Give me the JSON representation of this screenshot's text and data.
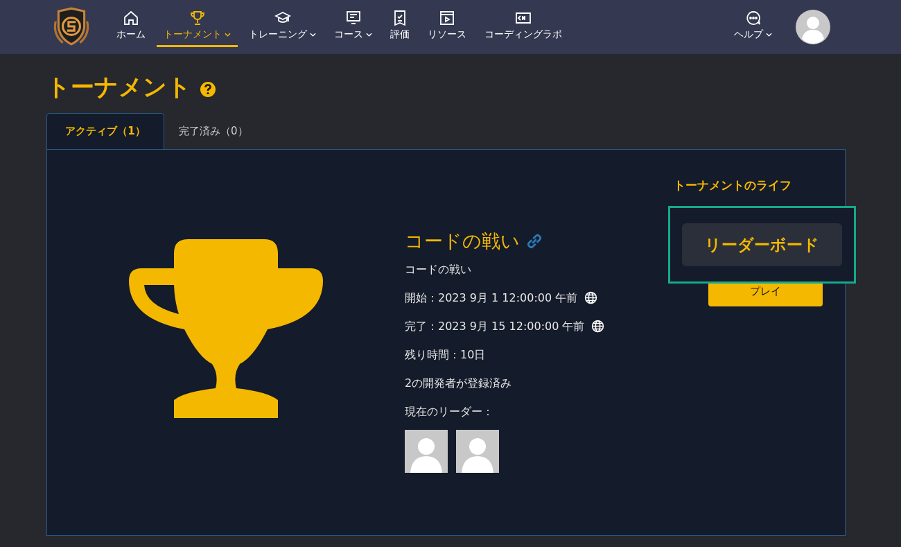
{
  "nav": {
    "items": [
      {
        "kind": "home",
        "label": "ホーム",
        "dropdown": false,
        "selected": false
      },
      {
        "kind": "trophy",
        "label": "トーナメント",
        "dropdown": true,
        "selected": true
      },
      {
        "kind": "cap",
        "label": "トレーニング",
        "dropdown": true,
        "selected": false
      },
      {
        "kind": "course",
        "label": "コース",
        "dropdown": true,
        "selected": false
      },
      {
        "kind": "review",
        "label": "評価",
        "dropdown": false,
        "selected": false
      },
      {
        "kind": "video",
        "label": "リソース",
        "dropdown": false,
        "selected": false
      },
      {
        "kind": "code",
        "label": "コーディングラボ",
        "dropdown": false,
        "selected": false
      }
    ],
    "help": {
      "label": "ヘルプ",
      "dropdown": true
    }
  },
  "page_title": "トーナメント",
  "tabs": [
    {
      "label": "アクティブ（1）",
      "selected": true
    },
    {
      "label": "完了済み（0）",
      "selected": false
    }
  ],
  "tournament": {
    "name": "コードの戦い",
    "description": "コードの戦い",
    "info": [
      {
        "text": "開始：2023 9月 1 12:00:00 午前",
        "globe": true
      },
      {
        "text": "完了：2023 9月 15 12:00:00 午前",
        "globe": true
      },
      {
        "text": "残り時間：10日",
        "globe": false
      },
      {
        "text": "2の開発者が登録済み",
        "globe": false
      },
      {
        "text": "現在のリーダー：",
        "globe": false
      }
    ],
    "leaders": [
      {
        "kind": "avatar"
      },
      {
        "kind": "avatar"
      }
    ]
  },
  "side": {
    "heading": "トーナメントのライフ",
    "leaderboard_button": "リーダーボード",
    "play_button": "プレイ"
  }
}
